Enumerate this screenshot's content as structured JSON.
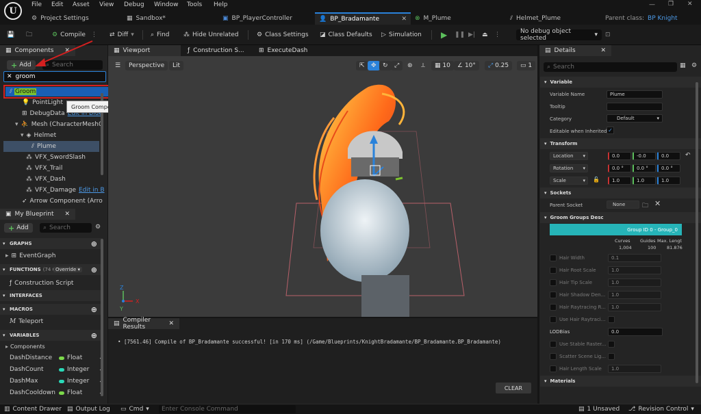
{
  "menu": [
    "File",
    "Edit",
    "Asset",
    "View",
    "Debug",
    "Window",
    "Tools",
    "Help"
  ],
  "tabs": [
    {
      "label": "Project Settings"
    },
    {
      "label": "Sandbox*"
    },
    {
      "label": "BP_PlayerController"
    },
    {
      "label": "BP_Bradamante",
      "active": true
    },
    {
      "label": "M_Plume"
    },
    {
      "label": "Helmet_Plume"
    }
  ],
  "parent_class": {
    "label": "Parent class:",
    "value": "BP Knight"
  },
  "toolbar": {
    "compile": "Compile",
    "diff": "Diff",
    "find": "Find",
    "hide_unrelated": "Hide Unrelated",
    "class_settings": "Class Settings",
    "class_defaults": "Class Defaults",
    "simulation": "Simulation",
    "debug_object": "No debug object selected"
  },
  "components": {
    "title": "Components",
    "add_label": "Add",
    "search_placeholder": "Search",
    "filter_value": "groom",
    "highlight": "Groom",
    "tooltip": "Groom Component",
    "items": [
      {
        "label": "PointLight"
      },
      {
        "label": "DebugData",
        "extra": "Edit in Blue"
      },
      {
        "label": "Mesh (CharacterMesh0"
      },
      {
        "label": "Helmet"
      },
      {
        "label": "Plume"
      },
      {
        "label": "VFX_SwordSlash"
      },
      {
        "label": "VFX_Trail"
      },
      {
        "label": "VFX_Dash"
      },
      {
        "label": "VFX_Damage",
        "extra": "Edit in B"
      },
      {
        "label": "Arrow Component (Arro"
      }
    ]
  },
  "blueprint": {
    "title": "My Blueprint",
    "add_label": "Add",
    "search_placeholder": "Search",
    "graphs": "GRAPHS",
    "event_graph": "EventGraph",
    "functions": "FUNCTIONS",
    "functions_count": "(74 OV",
    "override": "Override",
    "construction_script": "Construction Script",
    "interfaces": "INTERFACES",
    "macros": "MACROS",
    "teleport": "Teleport",
    "variables": "VARIABLES",
    "components_group": "Components",
    "vars": [
      {
        "name": "DashDistance",
        "type": "Float",
        "color": "#7cd94a"
      },
      {
        "name": "DashCount",
        "type": "Integer",
        "color": "#2ad9b8"
      },
      {
        "name": "DashMax",
        "type": "Integer",
        "color": "#2ad9b8"
      },
      {
        "name": "DashCooldown",
        "type": "Float",
        "color": "#7cd94a"
      }
    ]
  },
  "viewport": {
    "tabs": [
      "Viewport",
      "Construction S...",
      "ExecuteDash"
    ],
    "perspective": "Perspective",
    "lit": "Lit",
    "grid": "10",
    "angle": "10°",
    "scale": "0.25",
    "camera": "1"
  },
  "compiler": {
    "title": "Compiler Results",
    "message": "[7561.46] Compile of BP_Bradamante successful! [in 170 ms] (/Game/Blueprints/KnightBradamante/BP_Bradamante.BP_Bradamante)",
    "clear": "CLEAR"
  },
  "details": {
    "title": "Details",
    "search_placeholder": "Search",
    "variable": "Variable",
    "variable_name_label": "Variable Name",
    "variable_name": "Plume",
    "tooltip_label": "Tooltip",
    "category_label": "Category",
    "category": "Default",
    "editable_label": "Editable when Inherited",
    "transform": "Transform",
    "location": "Location",
    "location_vals": [
      "0.0",
      "-0.0",
      "0.0"
    ],
    "rotation": "Rotation",
    "rotation_vals": [
      "0.0 °",
      "0.0 °",
      "0.0 °"
    ],
    "scale": "Scale",
    "scale_vals": [
      "1.0",
      "1.0",
      "1.0"
    ],
    "sockets": "Sockets",
    "parent_socket_label": "Parent Socket",
    "parent_socket": "None",
    "groom_groups": "Groom Groups Desc",
    "group_button": "Group ID 0 - Group_0",
    "col_curves": "Curves",
    "col_guides": "Guides",
    "col_max": "Max. Lengt",
    "val_curves": "1,004",
    "val_guides": "100",
    "val_max": "81.876",
    "props": [
      {
        "label": "Hair Width",
        "value": "0.1"
      },
      {
        "label": "Hair Root Scale",
        "value": "1.0"
      },
      {
        "label": "Hair Tip Scale",
        "value": "1.0"
      },
      {
        "label": "Hair Shadow Den...",
        "value": "1.0"
      },
      {
        "label": "Hair Raytracing R...",
        "value": "1.0"
      },
      {
        "label": "Use Hair Raytraci...",
        "value": ""
      },
      {
        "label": "LODBias",
        "value": "0.0"
      },
      {
        "label": "Use Stable Raster...",
        "value": ""
      },
      {
        "label": "Scatter Scene Lig...",
        "value": ""
      },
      {
        "label": "Hair Length Scale",
        "value": "1.0"
      }
    ],
    "materials": "Materials"
  },
  "status": {
    "content_drawer": "Content Drawer",
    "output_log": "Output Log",
    "cmd": "Cmd",
    "console_placeholder": "Enter Console Command",
    "unsaved": "1 Unsaved",
    "revision": "Revision Control"
  },
  "colors": {
    "accent": "#2a82da",
    "teal": "#26b4b8",
    "highlight": "#1a5fb4",
    "annotation": "#d42020"
  }
}
